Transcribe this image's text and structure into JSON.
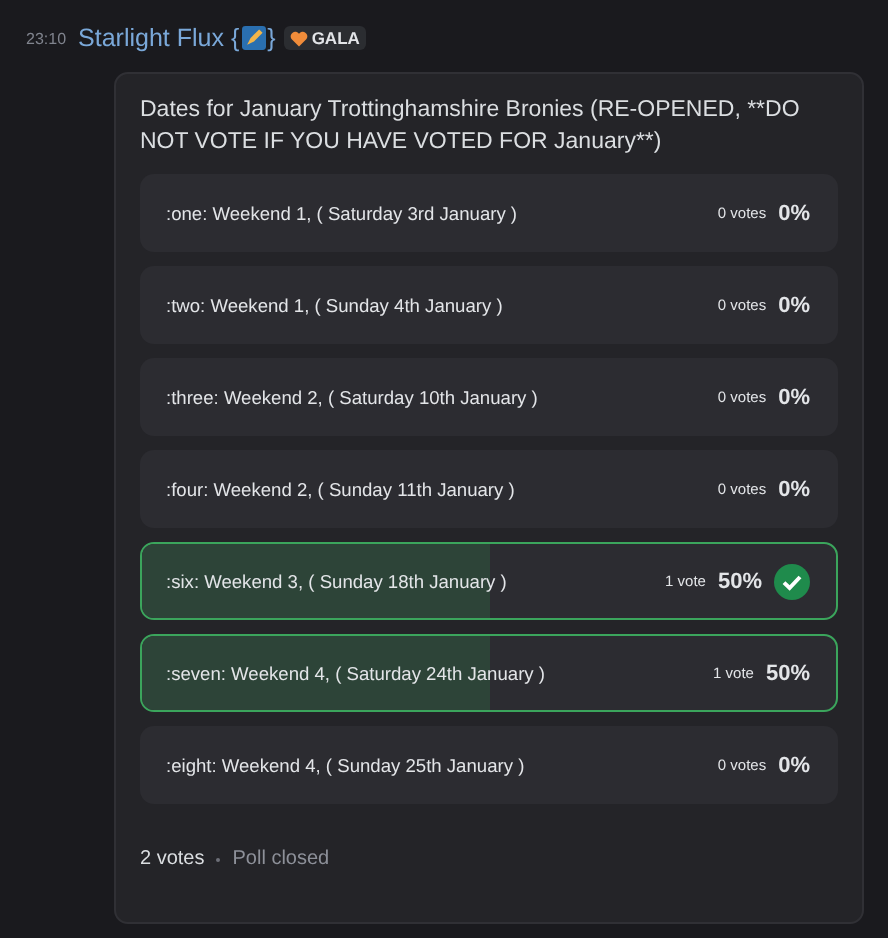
{
  "message": {
    "time": "23:10",
    "author": "Starlight Flux {",
    "author_end": "}",
    "tag": "GALA"
  },
  "poll": {
    "question": "Dates for January Trottinghamshire Bronies (RE-OPENED, **DO NOT VOTE IF YOU HAVE VOTED FOR January**)",
    "options": [
      {
        "label": ":one: Weekend 1, ( Saturday 3rd January )",
        "votes": "0 votes",
        "percent": "0%",
        "level": 0,
        "winner": false,
        "voted": false
      },
      {
        "label": ":two: Weekend 1, ( Sunday 4th January )",
        "votes": "0 votes",
        "percent": "0%",
        "level": 0,
        "winner": false,
        "voted": false
      },
      {
        "label": ":three: Weekend 2, ( Saturday 10th January )",
        "votes": "0 votes",
        "percent": "0%",
        "level": 0,
        "winner": false,
        "voted": false
      },
      {
        "label": ":four: Weekend 2, ( Sunday 11th January )",
        "votes": "0 votes",
        "percent": "0%",
        "level": 0,
        "winner": false,
        "voted": false
      },
      {
        "label": ":six: Weekend 3, ( Sunday 18th January )",
        "votes": "1 vote",
        "percent": "50%",
        "level": 0.5,
        "winner": true,
        "voted": true
      },
      {
        "label": ":seven: Weekend 4, ( Saturday 24th January )",
        "votes": "1 vote",
        "percent": "50%",
        "level": 0.5,
        "winner": true,
        "voted": false
      },
      {
        "label": ":eight: Weekend 4, ( Sunday 25th January )",
        "votes": "0 votes",
        "percent": "0%",
        "level": 0,
        "winner": false,
        "voted": false
      }
    ],
    "total": "2 votes",
    "status": "Poll closed"
  }
}
